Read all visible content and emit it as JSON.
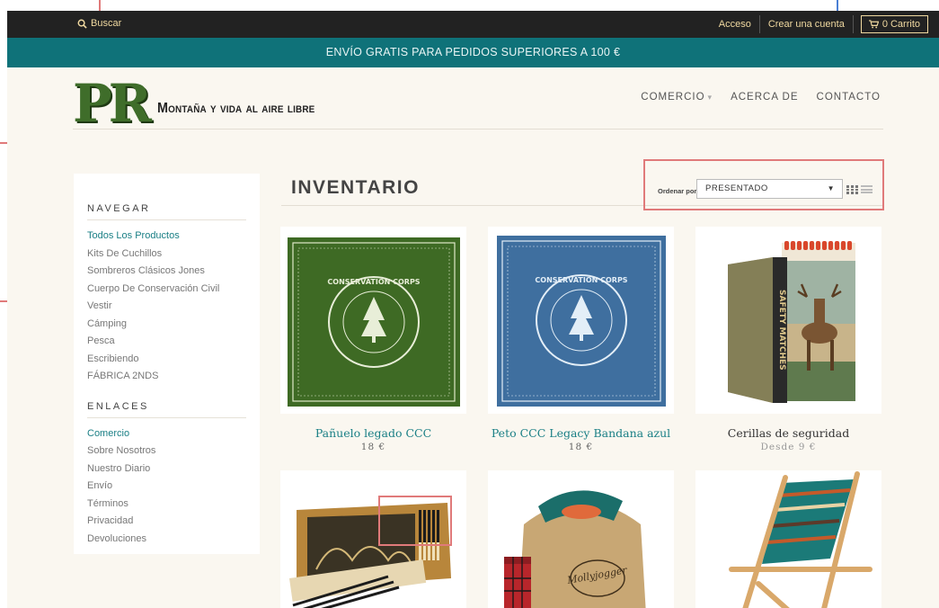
{
  "topbar": {
    "search_label": "Buscar",
    "login": "Acceso",
    "register": "Crear una cuenta",
    "cart": "0 Carrito"
  },
  "promo": "ENVÍO GRATIS PARA PEDIDOS SUPERIORES A 100 €",
  "logo": {
    "mark": "PR",
    "tagline": "Montaña y vida al aire libre"
  },
  "nav": {
    "shop": "COMERCIO",
    "about": "ACERCA DE",
    "contact": "CONTACTO"
  },
  "sidebar": {
    "browse_title": "NAVEGAR",
    "browse": [
      "Todos Los Productos",
      "Kits De Cuchillos",
      "Sombreros Clásicos Jones",
      "Cuerpo De Conservación Civil",
      "Vestir",
      "Cámping",
      "Pesca",
      "Escribiendo",
      "FÁBRICA 2NDS"
    ],
    "links_title": "ENLACES",
    "links": [
      "Comercio",
      "Sobre Nosotros",
      "Nuestro Diario",
      "Envío",
      "Términos",
      "Privacidad",
      "Devoluciones"
    ]
  },
  "page_title": "INVENTARIO",
  "sort": {
    "label": "Ordenar por",
    "value": "PRESENTADO"
  },
  "products": [
    {
      "name": "Pañuelo legado CCC",
      "price": "18 €",
      "color": "#3e6a24",
      "badge_text": "CONSERVATION CORPS"
    },
    {
      "name": "Peto CCC Legacy Bandana azul",
      "price": "18 €",
      "color": "#3f6f9f",
      "badge_text": "CONSERVATION CORPS"
    },
    {
      "name": "Cerillas de seguridad",
      "price": "Desde 9 €",
      "color": "#c8b48a",
      "box_text": "SAFETY MATCHES"
    },
    {
      "name": "",
      "price": "",
      "color": "#b8863b"
    },
    {
      "name": "",
      "price": "",
      "color": "#c8a774",
      "bag_text": "Mollyjogger"
    },
    {
      "name": "",
      "price": "",
      "color": "#1b7a78"
    }
  ],
  "colors": {
    "accent": "#0f7279",
    "link": "#1a7f85",
    "annotation": "#e07a7a"
  }
}
